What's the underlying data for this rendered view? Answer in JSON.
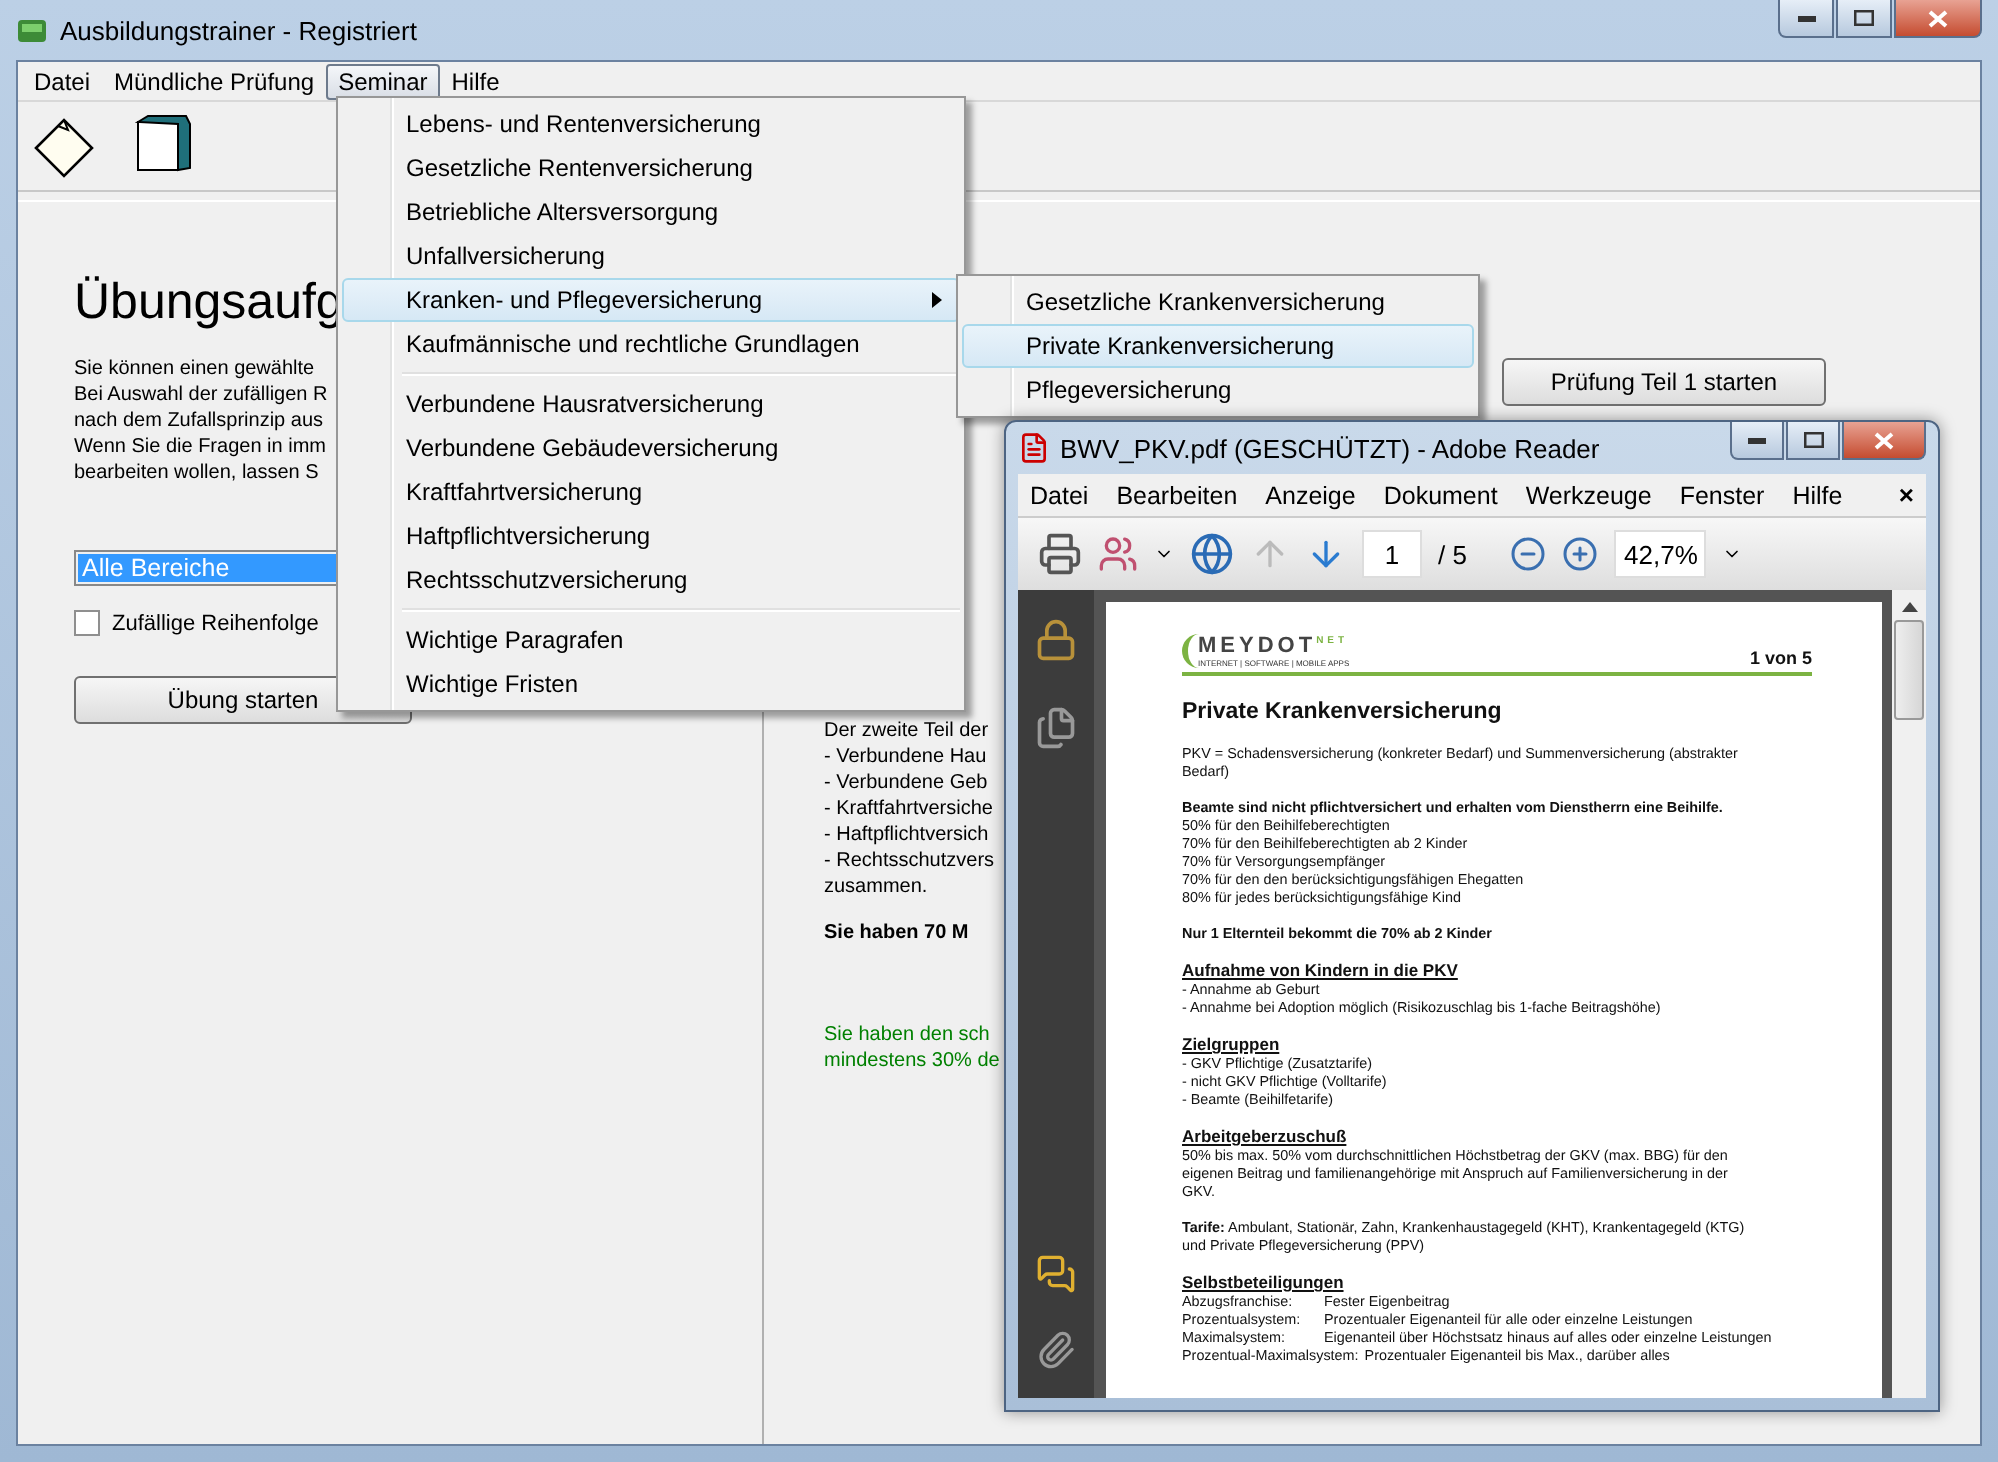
{
  "window": {
    "title": "Ausbildungstrainer - Registriert"
  },
  "menubar": [
    {
      "label": "Datei",
      "selected": false
    },
    {
      "label": "Mündliche Prüfung",
      "selected": false
    },
    {
      "label": "Seminar",
      "selected": true
    },
    {
      "label": "Hilfe",
      "selected": false
    }
  ],
  "left_panel": {
    "heading": "Übungsaufg",
    "intro_lines": [
      "Sie können einen gewählte",
      "Bei Auswahl der zufälligen R",
      "nach dem Zufallsprinzip aus",
      "Wenn Sie die Fragen in imm",
      "bearbeiten wollen, lassen S"
    ],
    "area_select": "Alle Bereiche",
    "random_order": {
      "label": "Zufällige Reihenfolge",
      "checked": false
    },
    "start_button": "Übung starten"
  },
  "right_panel": {
    "start_button": "Prüfung Teil 1 starten",
    "lines": [
      "Der zweite Teil der",
      "- Verbundene Hau",
      "- Verbundene Geb",
      "- Kraftfahrtversiche",
      "- Haftpflichtversich",
      "- Rechtsschutzvers",
      "zusammen."
    ],
    "time_note": "Sie haben 70 M",
    "pass_lines": [
      "Sie haben den sch",
      "mindestens 30% de"
    ]
  },
  "seminar_menu": [
    {
      "kind": "item",
      "label": "Lebens- und Rentenversicherung",
      "selected": false
    },
    {
      "kind": "item",
      "label": "Gesetzliche Rentenversicherung",
      "selected": false
    },
    {
      "kind": "item",
      "label": "Betriebliche Altersversorgung",
      "selected": false
    },
    {
      "kind": "item",
      "label": "Unfallversicherung",
      "selected": false
    },
    {
      "kind": "submenu",
      "label": "Kranken- und Pflegeversicherung",
      "selected": true
    },
    {
      "kind": "item",
      "label": "Kaufmännische und rechtliche Grundlagen",
      "selected": false
    },
    {
      "kind": "separator"
    },
    {
      "kind": "item",
      "label": "Verbundene Hausratversicherung",
      "selected": false
    },
    {
      "kind": "item",
      "label": "Verbundene Gebäudeversicherung",
      "selected": false
    },
    {
      "kind": "item",
      "label": "Kraftfahrtversicherung",
      "selected": false
    },
    {
      "kind": "item",
      "label": "Haftpflichtversicherung",
      "selected": false
    },
    {
      "kind": "item",
      "label": "Rechtsschutzversicherung",
      "selected": false
    },
    {
      "kind": "separator"
    },
    {
      "kind": "item",
      "label": "Wichtige Paragrafen",
      "selected": false
    },
    {
      "kind": "item",
      "label": "Wichtige Fristen",
      "selected": false
    }
  ],
  "submenu": [
    {
      "label": "Gesetzliche Krankenversicherung",
      "selected": false
    },
    {
      "label": "Private Krankenversicherung",
      "selected": true
    },
    {
      "label": "Pflegeversicherung",
      "selected": false
    }
  ],
  "pdf_window": {
    "title": "BWV_PKV.pdf (GESCHÜTZT) - Adobe Reader",
    "menubar": [
      "Datei",
      "Bearbeiten",
      "Anzeige",
      "Dokument",
      "Werkzeuge",
      "Fenster",
      "Hilfe"
    ],
    "close_menu": "×",
    "page_input": "1",
    "page_total": "/ 5",
    "zoom": "42,7%",
    "page": {
      "logo": "MEYDOT",
      "logo_sup": "NET",
      "logo_tagline": "INTERNET | SOFTWARE | MOBILE APPS",
      "page_label": "1 von 5",
      "title": "Private Krankenversicherung",
      "blocks": [
        {
          "kind": "para",
          "lines": [
            "PKV = Schadensversicherung (konkreter Bedarf) und Summenversicherung (abstrakter",
            "Bedarf)"
          ]
        },
        {
          "kind": "para",
          "title": "Beamte sind nicht pflichtversichert und erhalten vom Dienstherrn eine Beihilfe.",
          "lines": [
            "50% für den Beihilfeberechtigten",
            "70% für den Beihilfeberechtigten ab 2 Kinder",
            "70% für Versorgungsempfänger",
            "70% für den den berücksichtigungsfähigen Ehegatten",
            "80% für jedes berücksichtigungsfähige Kind"
          ]
        },
        {
          "kind": "para",
          "title": "Nur 1 Elternteil bekommt die 70% ab 2 Kinder"
        },
        {
          "kind": "section",
          "title": "Aufnahme von Kindern in die PKV",
          "lines": [
            "- Annahme ab Geburt",
            "- Annahme bei Adoption möglich (Risikozuschlag bis 1-fache Beitragshöhe)"
          ]
        },
        {
          "kind": "section",
          "title": "Zielgruppen",
          "lines": [
            "- GKV Pflichtige (Zusatztarife)",
            "- nicht GKV Pflichtige (Volltarife)",
            "- Beamte (Beihilfetarife)"
          ]
        },
        {
          "kind": "section",
          "title": "Arbeitgeberzuschuß",
          "lines": [
            "50% bis max. 50% vom durchschnittlichen Höchstbetrag der GKV (max. BBG) für den",
            "eigenen Beitrag und familienangehörige mit Anspruch auf Familienversicherung in der",
            "GKV."
          ]
        },
        {
          "kind": "para",
          "lines": [
            "**Tarife:** Ambulant, Stationär, Zahn, Krankenhaustagegeld (KHT), Krankentagegeld (KTG)",
            "und Private Pflegeversicherung (PPV)"
          ]
        },
        {
          "kind": "table",
          "title": "Selbstbeteiligungen",
          "rows": [
            {
              "label": "Abzugsfranchise:",
              "value": "Fester Eigenbeitrag"
            },
            {
              "label": "Prozentualsystem:",
              "value": "Prozentualer Eigenanteil für alle oder einzelne Leistungen"
            },
            {
              "label": "Maximalsystem:",
              "value": "Eigenanteil über Höchstsatz hinaus auf alles oder einzelne Leistungen"
            },
            {
              "label": "Prozentual-Maximalsystem:",
              "value": "Prozentualer Eigenanteil bis Max., darüber alles"
            }
          ]
        }
      ]
    }
  }
}
